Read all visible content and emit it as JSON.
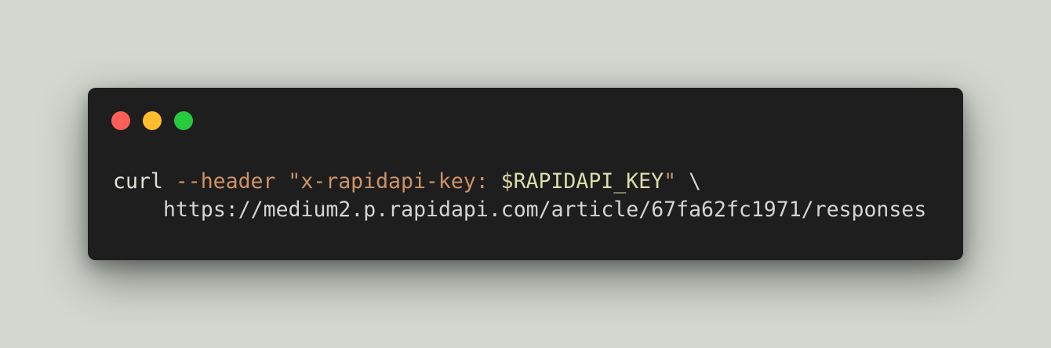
{
  "window": {
    "controls": {
      "close_color": "#ff5f56",
      "minimize_color": "#ffbd2e",
      "zoom_color": "#27c93f"
    }
  },
  "code": {
    "line1": {
      "command": "curl",
      "flag": "--header",
      "string_open": "\"x-rapidapi-key: ",
      "variable": "$RAPIDAPI_KEY",
      "string_close": "\"",
      "continuation": "\\"
    },
    "line2": {
      "url": "https://medium2.p.rapidapi.com/article/67fa62fc1971/responses"
    }
  }
}
